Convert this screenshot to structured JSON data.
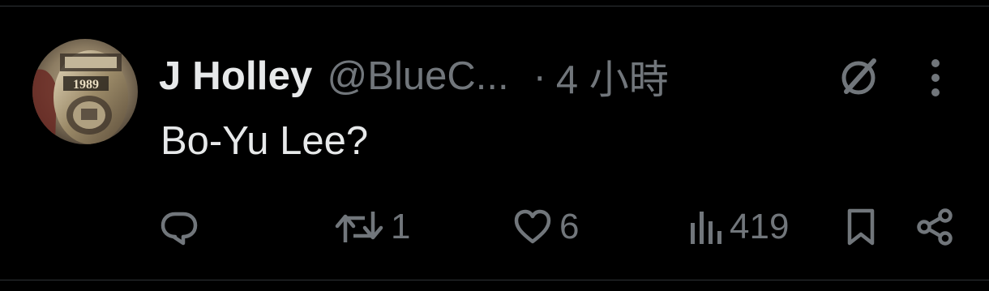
{
  "tweet": {
    "display_name": "J Holley",
    "handle": "@BlueC...",
    "separator": "·",
    "time": "4 小時",
    "text": "Bo-Yu Lee?",
    "avatar_text": "1989"
  },
  "actions": {
    "reply_icon": "reply-icon",
    "retweet_icon": "retweet-icon",
    "retweet_count": "1",
    "like_icon": "heart-icon",
    "like_count": "6",
    "views_icon": "views-icon",
    "views_count": "419",
    "bookmark_icon": "bookmark-icon",
    "share_icon": "share-icon"
  },
  "header_icons": {
    "grok": "grok-icon",
    "more": "more-icon"
  },
  "colors": {
    "background": "#000000",
    "primary_text": "#e7e9ea",
    "secondary_text": "#71767b",
    "divider": "#2f3336"
  }
}
